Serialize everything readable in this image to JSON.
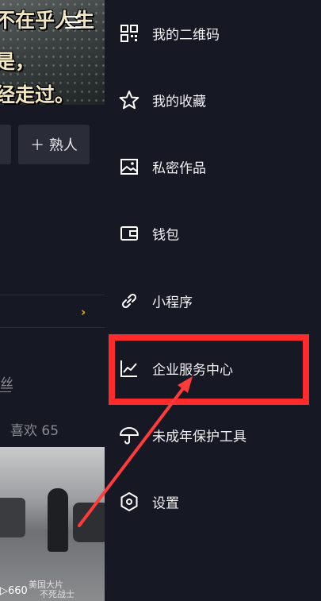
{
  "background": {
    "banner_lines": [
      "不在乎人生",
      "是，",
      "经走过。"
    ],
    "friend_button_label": "＋ 熟人",
    "fans_label": "丝",
    "likes_label": "喜欢 65",
    "video": {
      "view_count": "660",
      "title_lines": [
        "美国大片",
        "不死战士"
      ]
    }
  },
  "menu": {
    "items": [
      {
        "label": "我的二维码",
        "icon": "qr-code-icon"
      },
      {
        "label": "我的收藏",
        "icon": "star-icon"
      },
      {
        "label": "私密作品",
        "icon": "image-icon"
      },
      {
        "label": "钱包",
        "icon": "wallet-icon"
      },
      {
        "label": "小程序",
        "icon": "link-icon"
      },
      {
        "label": "企业服务中心",
        "icon": "chart-icon"
      },
      {
        "label": "未成年保护工具",
        "icon": "umbrella-icon"
      },
      {
        "label": "设置",
        "icon": "hexagon-settings-icon"
      }
    ]
  },
  "annotation": {
    "highlight_color": "#ff2b2b",
    "highlighted_item": "企业服务中心"
  }
}
